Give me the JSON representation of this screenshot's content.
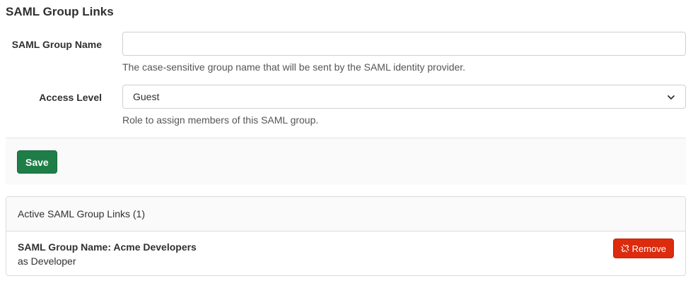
{
  "page": {
    "title": "SAML Group Links"
  },
  "form": {
    "group_name": {
      "label": "SAML Group Name",
      "value": "",
      "placeholder": "",
      "help": "The case-sensitive group name that will be sent by the SAML identity provider."
    },
    "access_level": {
      "label": "Access Level",
      "selected": "Guest",
      "help": "Role to assign members of this SAML group."
    },
    "save_label": "Save"
  },
  "links": {
    "header": "Active SAML Group Links (1)",
    "items": [
      {
        "name": "SAML Group Name: Acme Developers",
        "access": "as Developer",
        "remove_label": "Remove"
      }
    ]
  },
  "colors": {
    "save_button": "#1f7e48",
    "remove_button": "#dd2b0e"
  },
  "icons": {
    "select_chevron": "chevron-down-icon",
    "remove": "unlink-icon"
  }
}
